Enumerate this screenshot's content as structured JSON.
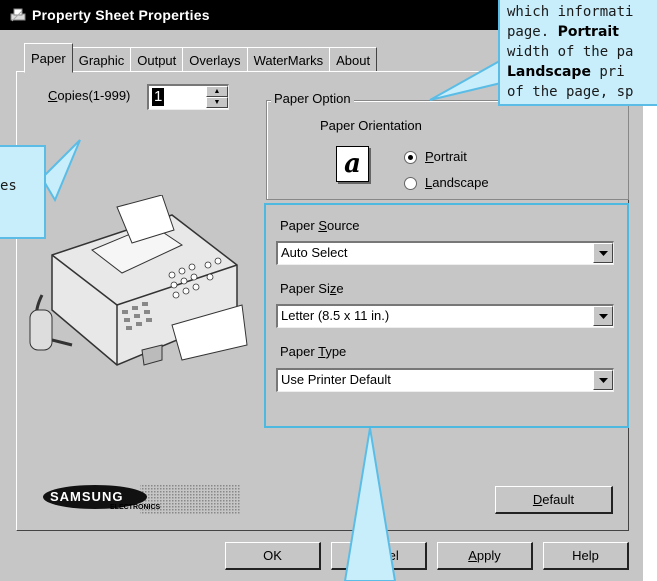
{
  "window": {
    "title": "Property Sheet Properties"
  },
  "tabs": [
    "Paper",
    "Graphic",
    "Output",
    "Overlays",
    "WaterMarks",
    "About"
  ],
  "active_tab": "Paper",
  "copies": {
    "label_pre": "",
    "label_u": "C",
    "label_post": "opies(1-999)",
    "value": "1"
  },
  "paper_option": {
    "caption": "Paper Option",
    "orientation_label": "Paper Orientation",
    "portrait_u": "P",
    "portrait_rest": "ortrait",
    "landscape_u": "L",
    "landscape_rest": "andscape",
    "selected": "Portrait"
  },
  "paper_source": {
    "pre": "Paper ",
    "u": "S",
    "post": "ource",
    "value": "Auto Select"
  },
  "paper_size": {
    "pre": "Paper Si",
    "u": "z",
    "post": "e",
    "value": "Letter (8.5 x 11 in.)"
  },
  "paper_type": {
    "pre": "Paper ",
    "u": "T",
    "post": "ype",
    "value": "Use Printer Default"
  },
  "buttons": {
    "default_u": "D",
    "default_rest": "efault",
    "ok": "OK",
    "cancel": "Cancel",
    "apply_u": "A",
    "apply_rest": "pply",
    "help": "Help"
  },
  "logo": {
    "brand": "SAMSUNG",
    "sub": "ELECTRONICS"
  },
  "callout_right": {
    "line1": "which informati",
    "line2_pre": "page. ",
    "line2_bold": "Portrait",
    "line3": "width of the pa",
    "line4_bold": "Landscape",
    "line4_post": " pri",
    "line5": "of the page, sp"
  },
  "callout_left": {
    "text": "es"
  },
  "colors": {
    "callout_fill": "#c8eefc",
    "callout_border": "#5bbde6",
    "titlebar": "#000000",
    "face": "#c6c6c6"
  }
}
